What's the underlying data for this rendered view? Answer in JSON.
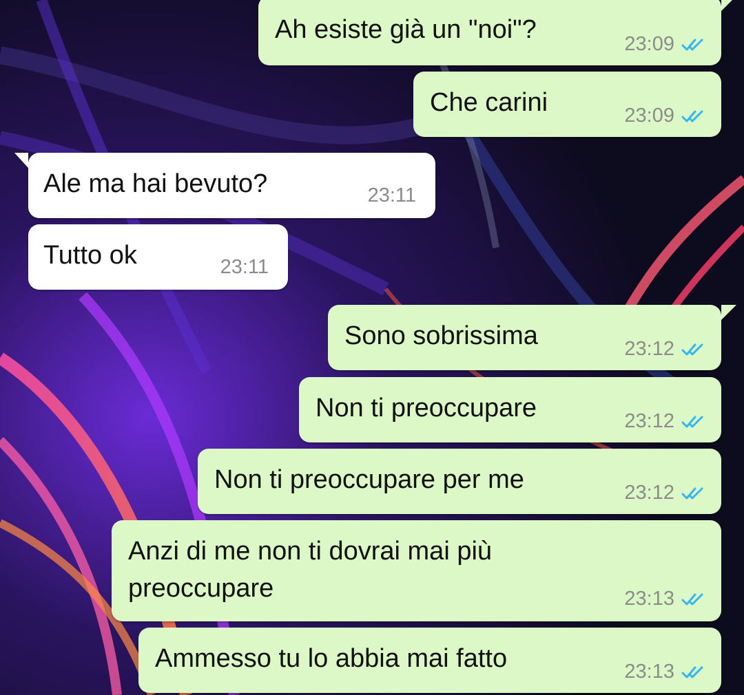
{
  "colors": {
    "outgoing_bubble": "#dcf8c6",
    "incoming_bubble": "#ffffff",
    "time_text": "#8b8b8b",
    "read_ticks": "#34b7f1"
  },
  "icons": {
    "read_receipt": "double-check-icon"
  },
  "messages": [
    {
      "direction": "out",
      "text": "Ah esiste già un \"noi\"?",
      "time": "23:09",
      "read": true
    },
    {
      "direction": "out",
      "text": "Che carini",
      "time": "23:09",
      "read": true
    },
    {
      "direction": "in",
      "text": "Ale ma hai bevuto?",
      "time": "23:11"
    },
    {
      "direction": "in",
      "text": "Tutto ok",
      "time": "23:11"
    },
    {
      "direction": "out",
      "text": "Sono sobrissima",
      "time": "23:12",
      "read": true
    },
    {
      "direction": "out",
      "text": "Non ti preoccupare",
      "time": "23:12",
      "read": true
    },
    {
      "direction": "out",
      "text": "Non ti preoccupare per me",
      "time": "23:12",
      "read": true
    },
    {
      "direction": "out",
      "text": "Anzi di me non ti dovrai mai più\npreoccupare",
      "time": "23:13",
      "read": true
    },
    {
      "direction": "out",
      "text": "Ammesso tu lo abbia mai fatto",
      "time": "23:13",
      "read": true
    }
  ]
}
